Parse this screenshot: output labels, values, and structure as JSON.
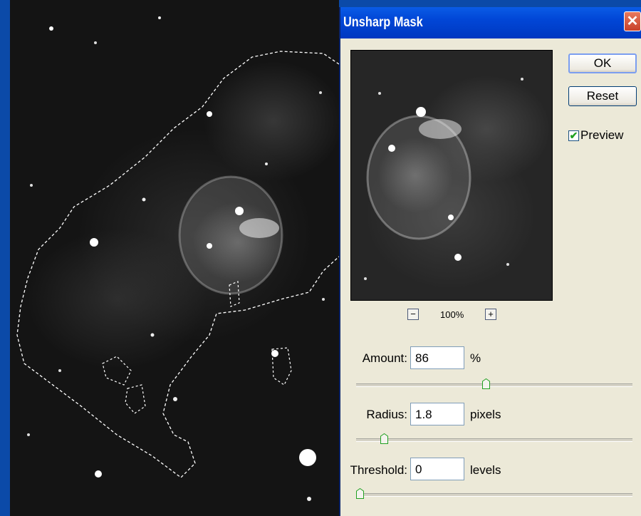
{
  "dialog": {
    "title": "Unsharp Mask",
    "close_glyph": "✕",
    "ok_label": "OK",
    "reset_label": "Reset",
    "preview_label": "Preview",
    "preview_checked": true,
    "zoom_out_glyph": "−",
    "zoom_in_glyph": "+",
    "zoom_level": "100%",
    "amount": {
      "label": "Amount:",
      "value": "86",
      "unit": "%",
      "slider_fraction": 0.47
    },
    "radius": {
      "label": "Radius:",
      "value": "1.8",
      "unit": "pixels",
      "slider_fraction": 0.09
    },
    "threshold": {
      "label": "Threshold:",
      "value": "0",
      "unit": "levels",
      "slider_fraction": 0.0
    }
  },
  "colors": {
    "desktop": "#0b4aa8",
    "titlebar": "#0146d6",
    "dialog_face": "#ece9d8",
    "slider_thumb": "#21a121"
  }
}
